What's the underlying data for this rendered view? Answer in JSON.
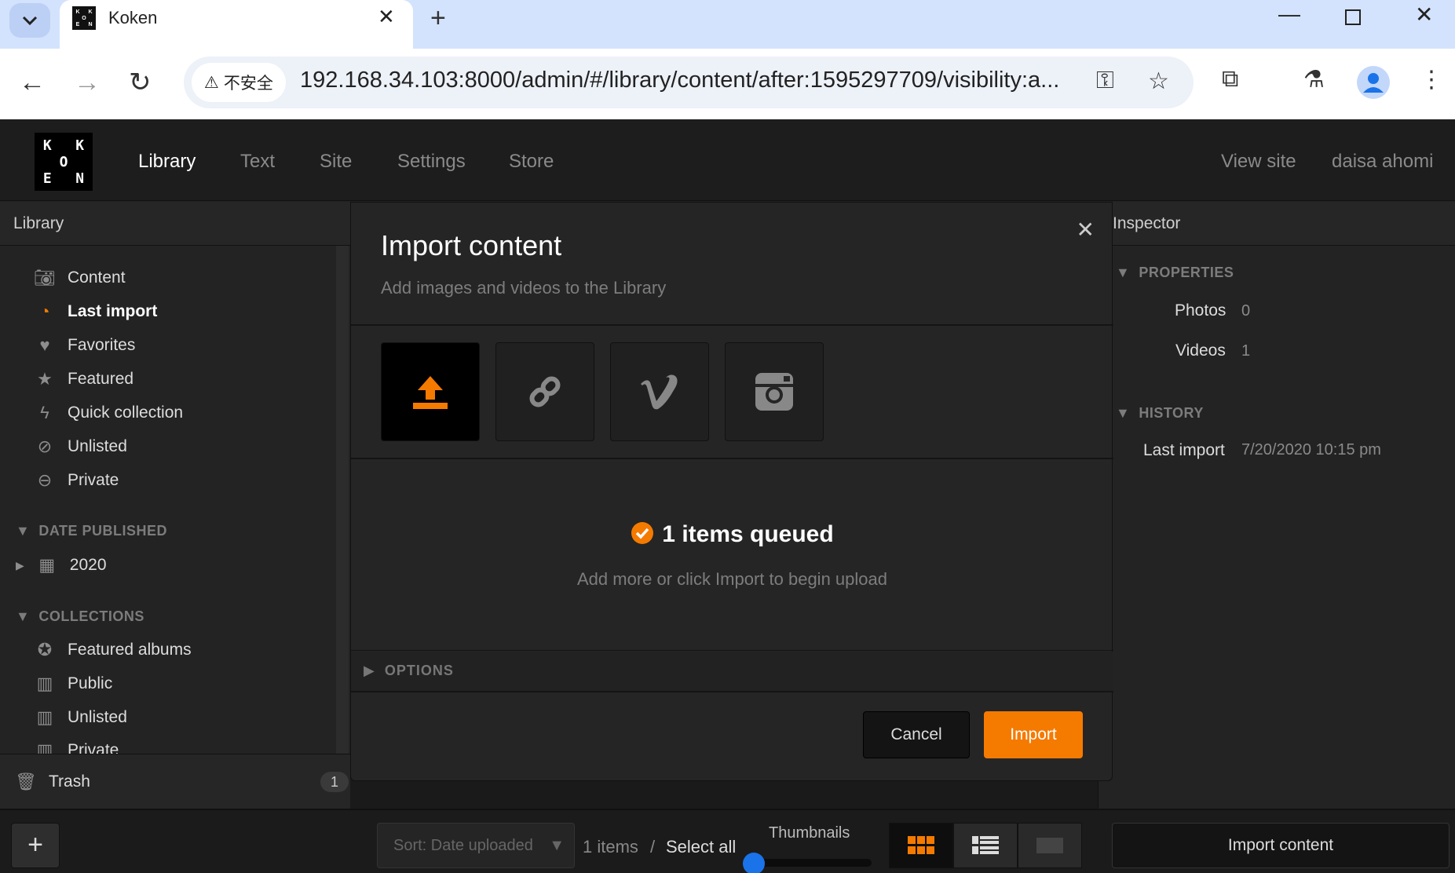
{
  "browser": {
    "tab_title": "Koken",
    "security_label": "不安全",
    "url": "192.168.34.103:8000/admin/#/library/content/after:1595297709/visibility:a...",
    "favicon_letters": [
      "K",
      "",
      "K",
      "",
      "O",
      "",
      "E",
      "",
      "N"
    ]
  },
  "app": {
    "logo_letters": [
      "K",
      "",
      "K",
      "",
      "O",
      "",
      "E",
      "",
      "N"
    ],
    "nav": [
      "Library",
      "Text",
      "Site",
      "Settings",
      "Store"
    ],
    "view_site": "View site",
    "user": "daisa ahomi",
    "accent_color": "#f57a00"
  },
  "sidebar": {
    "title": "Library",
    "items": [
      {
        "label": "Content",
        "icon": "camera-icon"
      },
      {
        "label": "Last import",
        "icon": "clock-icon"
      },
      {
        "label": "Favorites",
        "icon": "heart-icon"
      },
      {
        "label": "Featured",
        "icon": "star-icon"
      },
      {
        "label": "Quick collection",
        "icon": "lightning-icon"
      },
      {
        "label": "Unlisted",
        "icon": "hidden-eye-icon"
      },
      {
        "label": "Private",
        "icon": "minus-circle-icon"
      }
    ],
    "date_section": "DATE PUBLISHED",
    "year": "2020",
    "collections_section": "COLLECTIONS",
    "collections": [
      "Featured albums",
      "Public",
      "Unlisted",
      "Private"
    ],
    "trash": "Trash",
    "trash_count": "1"
  },
  "inspector": {
    "title": "Inspector",
    "properties_section": "PROPERTIES",
    "photos_label": "Photos",
    "photos_value": "0",
    "videos_label": "Videos",
    "videos_value": "1",
    "history_section": "HISTORY",
    "last_import_label": "Last import",
    "last_import_value": "7/20/2020 10:15 pm"
  },
  "modal": {
    "title": "Import content",
    "subtitle": "Add images and videos to the Library",
    "sources": [
      "upload-icon",
      "link-icon",
      "vimeo-icon",
      "instagram-icon"
    ],
    "queued": "1 items queued",
    "queue_hint": "Add more or click Import to begin upload",
    "options_label": "OPTIONS",
    "cancel": "Cancel",
    "import": "Import"
  },
  "bottombar": {
    "sort_placeholder": "Sort: Date uploaded",
    "items_count": "1 items",
    "separator": "/",
    "select_all": "Select all",
    "thumbnails_label": "Thumbnails",
    "import_content": "Import content"
  }
}
